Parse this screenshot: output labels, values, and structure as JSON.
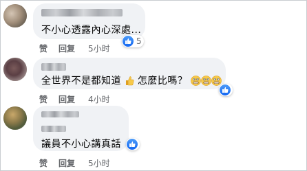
{
  "comments": [
    {
      "text": "不小心透露內心深處...",
      "reaction_count": "5",
      "actions": {
        "like": "赞",
        "reply": "回复",
        "time": "5小时"
      }
    },
    {
      "text": "全世界不是都知道",
      "text_after": "怎麼比嗎？",
      "actions": {
        "like": "赞",
        "reply": "回复",
        "time": "4小时"
      }
    },
    {
      "text": "議員不小心講真話",
      "actions": {
        "like": "赞",
        "reply": "回复",
        "time": "5小时"
      }
    }
  ],
  "icons": {
    "like_reaction": "thumbs-up-icon",
    "thumb_emoji": "thumbs-up-emoji",
    "grimace_emoji": "grimacing-face-emoji"
  },
  "colors": {
    "bubble": "#f0f2f5",
    "like_blue": "#1877f2",
    "meta_gray": "#65676b"
  }
}
